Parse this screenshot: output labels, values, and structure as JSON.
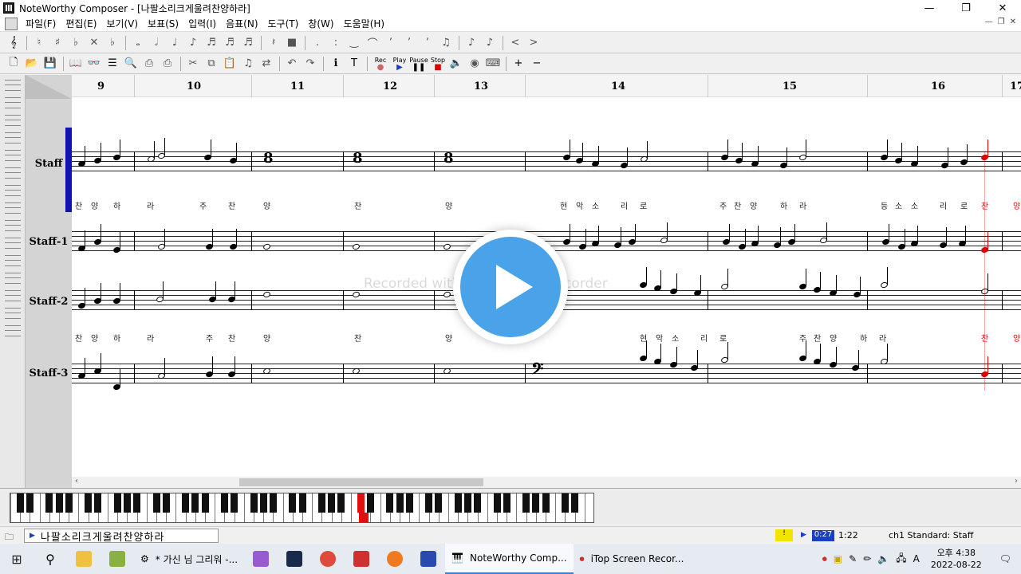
{
  "window": {
    "title": "NoteWorthy Composer - [나팔소리크게울려찬양하라]",
    "controls": [
      "—",
      "❐",
      "✕"
    ]
  },
  "menu": {
    "items": [
      "파일(F)",
      "편집(E)",
      "보기(V)",
      "보표(S)",
      "입력(I)",
      "음표(N)",
      "도구(T)",
      "창(W)",
      "도움말(H)"
    ]
  },
  "toolbar2": {
    "play_label": "Play",
    "pause_label": "Pause",
    "stop_label": "Stop",
    "rec_label": "Rec"
  },
  "score": {
    "bar_numbers": [
      "9",
      "10",
      "11",
      "12",
      "13",
      "14",
      "15",
      "16",
      "17"
    ],
    "staves": [
      {
        "label": "Staff"
      },
      {
        "label": "Staff-1"
      },
      {
        "label": "Staff-2"
      },
      {
        "label": "Staff-3"
      }
    ],
    "lyrics_line1": [
      "찬",
      "양",
      "하",
      "라",
      "주",
      "찬",
      "양",
      "찬",
      "양",
      "현",
      "악",
      "소",
      "리",
      "로",
      "주",
      "찬",
      "양",
      "하",
      "라",
      "등",
      "소",
      "소",
      "리",
      "로",
      "찬",
      "양"
    ],
    "lyrics_line2": [
      "찬",
      "양",
      "하",
      "라",
      "주",
      "찬",
      "양",
      "찬",
      "양",
      "현",
      "악",
      "소",
      "리",
      "로",
      "주",
      "찬",
      "양",
      "하",
      "라",
      "찬",
      "양"
    ],
    "watermark": "Recorded with iTop Screen Recorder"
  },
  "status": {
    "file_name": "나팔소리크게울려찬양하라",
    "position_marker": "!",
    "current_time": "0:27",
    "total_time": "1:22",
    "staff_info": "ch1 Standard: Staff"
  },
  "taskbar": {
    "tasks": [
      {
        "label": "* 가신 님 그리워 -...",
        "active": false
      },
      {
        "label": "NoteWorthy Comp...",
        "active": true
      },
      {
        "label": "iTop Screen Recor...",
        "active": false
      }
    ],
    "clock_time": "오후 4:38",
    "clock_date": "2022-08-22",
    "input_indicator": "A"
  },
  "colors": {
    "selection": "#1212b4",
    "playhead": "#dd0000",
    "play_button": "#4aa3e8"
  }
}
